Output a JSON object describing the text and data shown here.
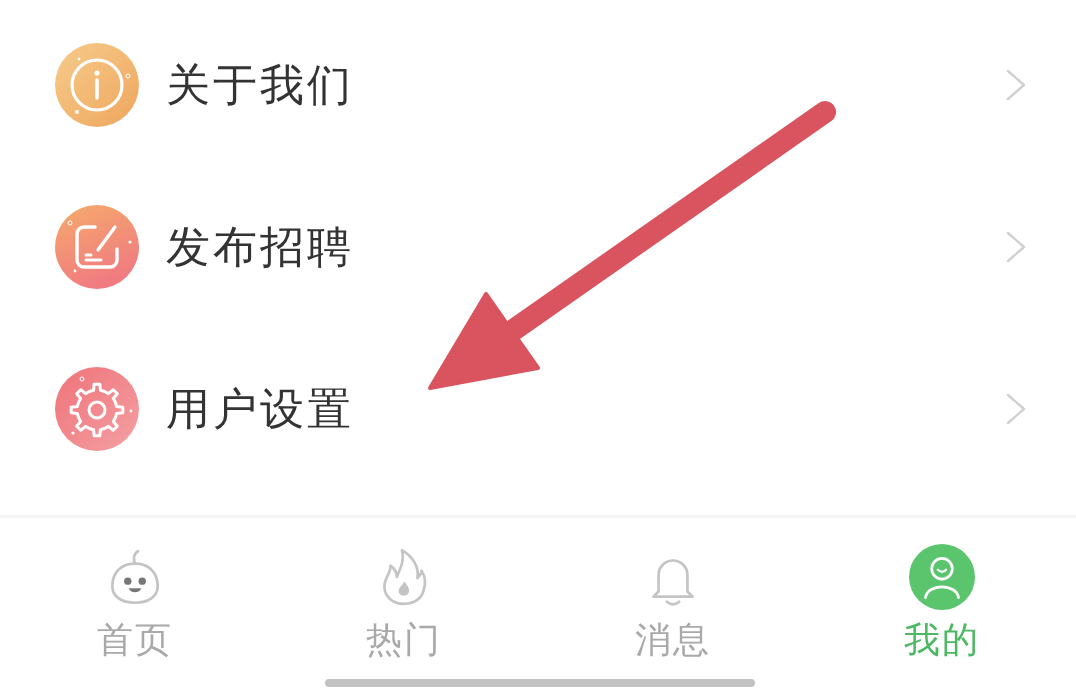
{
  "menu": {
    "items": [
      {
        "label": "关于我们"
      },
      {
        "label": "发布招聘"
      },
      {
        "label": "用户设置"
      }
    ]
  },
  "tab_bar": {
    "tabs": [
      {
        "label": "首页",
        "selected": false
      },
      {
        "label": "热门",
        "selected": false
      },
      {
        "label": "消息",
        "selected": false
      },
      {
        "label": "我的",
        "selected": true
      }
    ]
  }
}
